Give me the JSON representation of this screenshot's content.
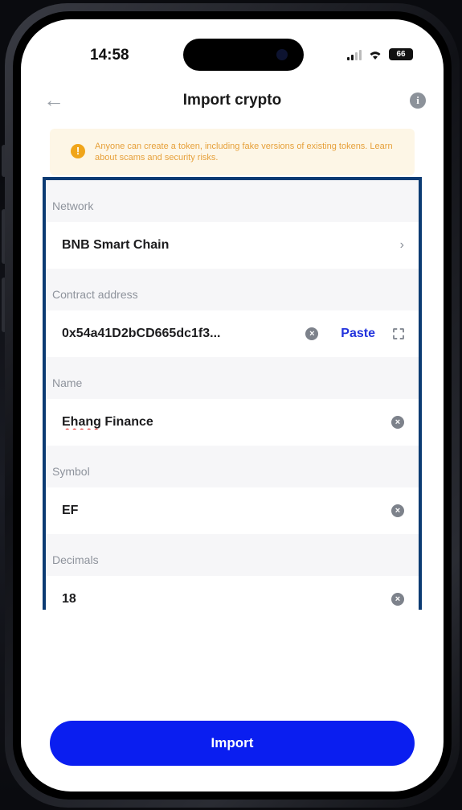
{
  "status_bar": {
    "time": "14:58",
    "battery": "66"
  },
  "header": {
    "title": "Import crypto"
  },
  "warning": {
    "text": "Anyone can create a token, including fake versions of existing tokens. Learn about scams and security risks."
  },
  "form": {
    "network": {
      "label": "Network",
      "value": "BNB Smart Chain"
    },
    "contract": {
      "label": "Contract address",
      "value": "0x54a41D2bCD665dc1f3...",
      "paste_label": "Paste"
    },
    "name": {
      "label": "Name",
      "value_misspelled": "Ehang",
      "value_rest": " Finance"
    },
    "symbol": {
      "label": "Symbol",
      "value": "EF"
    },
    "decimals": {
      "label": "Decimals",
      "value": "18"
    }
  },
  "import_button": {
    "label": "Import"
  },
  "colors": {
    "accent": "#0a1ef0",
    "highlight_border": "#0c3b73",
    "warning_text": "#e6a03a"
  },
  "icons": [
    "back-arrow-icon",
    "info-icon",
    "warning-icon",
    "chevron-right-icon",
    "clear-icon",
    "scan-icon",
    "signal-icon",
    "wifi-icon",
    "battery-icon"
  ]
}
